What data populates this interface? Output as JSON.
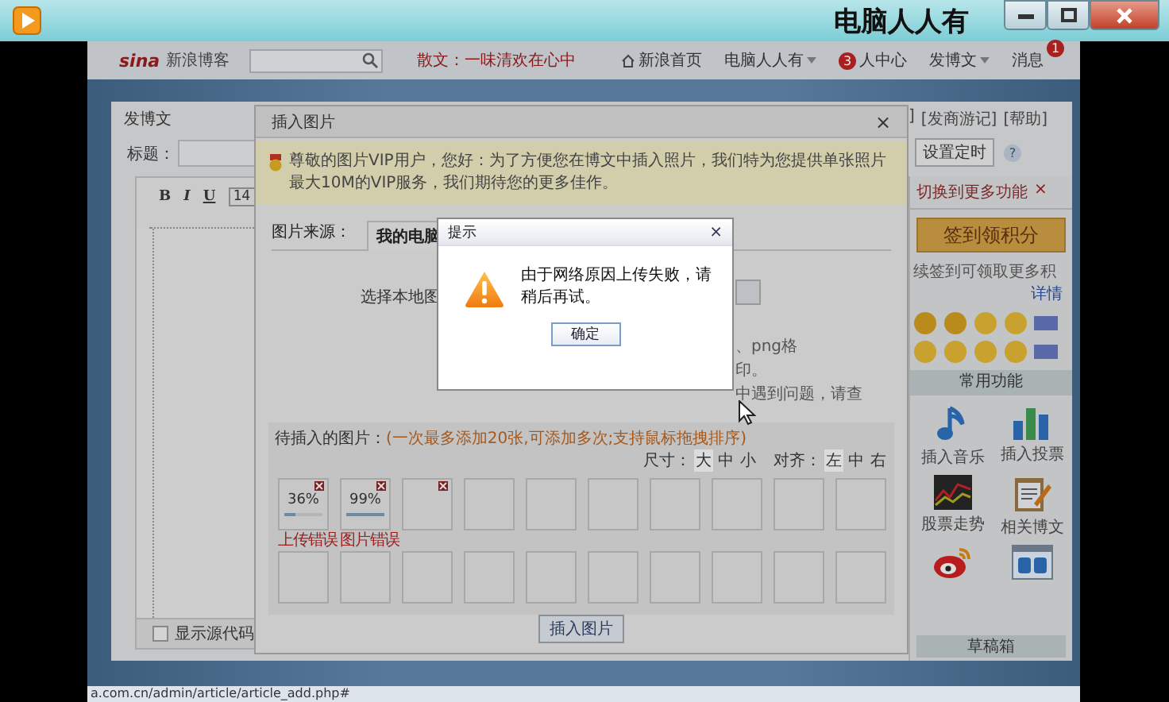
{
  "window": {
    "title": "电脑人人有"
  },
  "nav": {
    "logo_mark": "sina",
    "logo": "新浪博客",
    "featured": "散文：一味清欢在心中",
    "links": [
      {
        "label": "新浪首页",
        "kind": "home"
      },
      {
        "label": "电脑人人有",
        "kind": "menu"
      },
      {
        "label": "人中心",
        "kind": "badge_before",
        "badge": "3"
      },
      {
        "label": "发博文",
        "kind": "menu"
      },
      {
        "label": "消息",
        "kind": "badge_after",
        "badge": "1"
      }
    ]
  },
  "editor_card": {
    "title": "发博文",
    "header_links": [
      "]",
      "[发商游记]",
      "[帮助]"
    ],
    "title_label": "标题：",
    "toolbar": [
      "B",
      "I",
      "U",
      "14"
    ],
    "show_source": {
      "label": "显示源代码",
      "checked": false
    },
    "schedule_button": "设置定时",
    "help": "?"
  },
  "sidebar": {
    "switch_link": "切换到更多功能",
    "close": "×",
    "checkin_button": "签到领积分",
    "checkin_note": "续签到可领取更多积",
    "details_link": "详情",
    "section_title": "常用功能",
    "tools": [
      {
        "kind": "music",
        "label": "插入音乐"
      },
      {
        "kind": "poll",
        "label": "插入投票"
      },
      {
        "kind": "stocks",
        "label": "股票走势"
      },
      {
        "kind": "related",
        "label": "相关博文"
      },
      {
        "kind": "weibo"
      },
      {
        "kind": "window"
      }
    ],
    "drafts_button": "草稿箱"
  },
  "insert_dialog": {
    "title": "插入图片",
    "close": "×",
    "notice": "尊敬的图片VIP用户，您好：为了方便您在博文中插入照片，我们特为您提供单张照片最大10M的VIP服务，我们期待您的更多佳作。",
    "source_label": "图片来源：",
    "tabs": [
      {
        "label": "我的电脑",
        "selected": true
      }
    ],
    "upload": {
      "prompt": "选择本地图",
      "hint_lines": [
        "、png格",
        "印。",
        "中遇到问题，请查"
      ]
    },
    "queue": {
      "label": "待插入的图片：",
      "note": "(一次最多添加20张,可添加多次;支持鼠标拖拽排序)",
      "size_label": "尺寸：",
      "sizes": [
        {
          "label": "大",
          "selected": true
        },
        {
          "label": "中",
          "selected": false
        },
        {
          "label": "小",
          "selected": false
        }
      ],
      "align_label": "对齐：",
      "aligns": [
        {
          "label": "左",
          "selected": true
        },
        {
          "label": "中",
          "selected": false
        },
        {
          "label": "右",
          "selected": false
        }
      ],
      "slots": [
        {
          "percent": "36%",
          "level": 0.3,
          "error": "上传错误",
          "removable": true
        },
        {
          "percent": "99%",
          "level": 0.99,
          "error": "图片错误",
          "removable": true
        },
        {
          "removable": true
        },
        {
          "removable": false
        },
        {
          "removable": false
        },
        {
          "removable": false
        },
        {
          "removable": false
        },
        {
          "removable": false
        },
        {
          "removable": false
        },
        {
          "removable": false
        },
        {
          "removable": false
        },
        {
          "removable": false
        },
        {
          "removable": false
        },
        {
          "removable": false
        },
        {
          "removable": false
        },
        {
          "removable": false
        },
        {
          "removable": false
        },
        {
          "removable": false
        },
        {
          "removable": false
        },
        {
          "removable": false
        }
      ]
    },
    "insert_button": "插入图片"
  },
  "alert": {
    "title": "提示",
    "close": "×",
    "message": "由于网络原因上传失败，请稍后再试。",
    "ok": "确定"
  },
  "status_url": "a.com.cn/admin/article/article_add.php#"
}
